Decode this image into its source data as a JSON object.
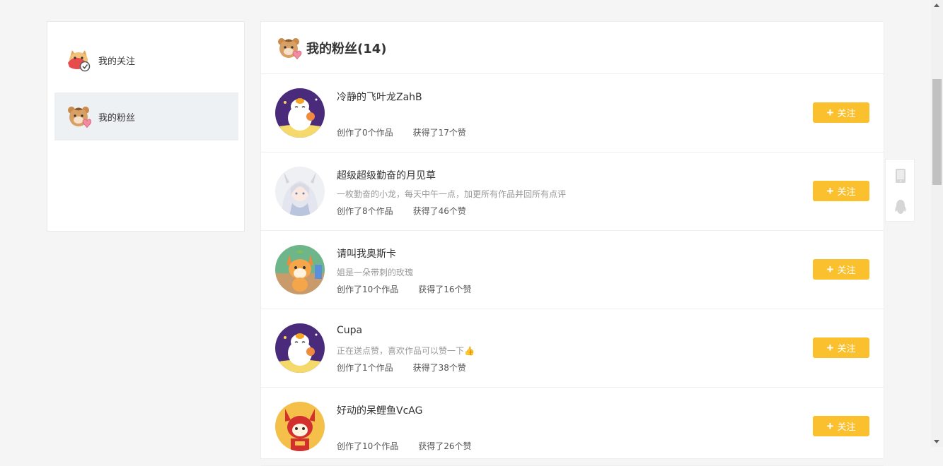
{
  "sidebar": {
    "items": [
      {
        "label": "我的关注",
        "icon": "follow-mascot-icon",
        "active": false
      },
      {
        "label": "我的粉丝",
        "icon": "fans-mascot-icon",
        "active": true
      }
    ]
  },
  "main": {
    "title": "我的粉丝(14)"
  },
  "fans": [
    {
      "name": "冷静的飞叶龙ZahB",
      "bio": "",
      "works": "创作了0个作品",
      "likes": "获得了17个赞",
      "avatar": "purple-mascot-avatar"
    },
    {
      "name": "超级超级勤奋的月见草",
      "bio": "一枚勤奋的小龙，每天中午一点，加更所有作品并回所有点评",
      "works": "创作了8个作品",
      "likes": "获得了46个赞",
      "avatar": "anime-girl-avatar"
    },
    {
      "name": "请叫我奥斯卡",
      "bio": "姐是一朵带刺的玫瑰",
      "works": "创作了10个作品",
      "likes": "获得了16个赞",
      "avatar": "fox-mascot-avatar"
    },
    {
      "name": "Cupa",
      "bio": "正在送点赞，喜欢作品可以赞一下👍",
      "works": "创作了1个作品",
      "likes": "获得了38个赞",
      "avatar": "purple-mascot-avatar"
    },
    {
      "name": "好动的呆鲤鱼VcAG",
      "bio": "",
      "works": "创作了10个作品",
      "likes": "获得了26个赞",
      "avatar": "red-mascot-avatar"
    }
  ],
  "follow_label": "关注",
  "colors": {
    "accent": "#fbc02d",
    "background": "#f5f5f5",
    "active_item": "#eef1f4"
  }
}
